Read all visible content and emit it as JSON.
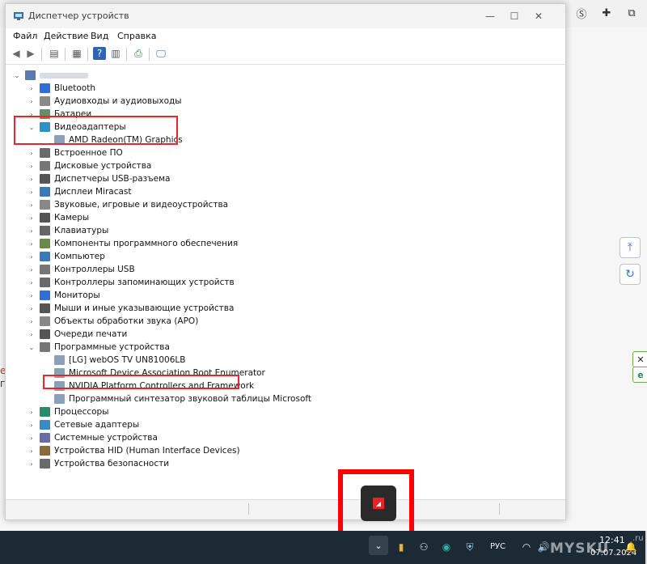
{
  "window": {
    "title": "Диспетчер устройств",
    "minimize": "—",
    "maximize": "☐",
    "close": "✕"
  },
  "menu": [
    "Файл",
    "Действие",
    "Вид",
    "Справка"
  ],
  "tree": {
    "root_expand": "⌄",
    "collapsed_glyph": "›",
    "expanded_glyph": "⌄",
    "items": [
      {
        "label": "Bluetooth"
      },
      {
        "label": "Аудиовходы и аудиовыходы"
      },
      {
        "label": "Батареи"
      },
      {
        "label": "Видеоадаптеры",
        "children": [
          "AMD Radeon(TM) Graphics"
        ]
      },
      {
        "label": "Встроенное ПО"
      },
      {
        "label": "Дисковые устройства"
      },
      {
        "label": "Диспетчеры USB-разъема"
      },
      {
        "label": "Дисплеи Miracast"
      },
      {
        "label": "Звуковые, игровые и видеоустройства"
      },
      {
        "label": "Камеры"
      },
      {
        "label": "Клавиатуры"
      },
      {
        "label": "Компоненты программного обеспечения"
      },
      {
        "label": "Компьютер"
      },
      {
        "label": "Контроллеры USB"
      },
      {
        "label": "Контроллеры запоминающих устройств"
      },
      {
        "label": "Мониторы"
      },
      {
        "label": "Мыши и иные указывающие устройства"
      },
      {
        "label": "Объекты обработки звука (APO)"
      },
      {
        "label": "Очереди печати"
      },
      {
        "label": "Программные устройства",
        "children": [
          "[LG] webOS TV UN81006LB",
          "Microsoft Device Association Root Enumerator",
          "NVIDIA Platform Controllers and Framework",
          "Программный синтезатор звуковой таблицы Microsoft"
        ]
      },
      {
        "label": "Процессоры"
      },
      {
        "label": "Сетевые адаптеры"
      },
      {
        "label": "Системные устройства"
      },
      {
        "label": "Устройства HID (Human Interface Devices)"
      },
      {
        "label": "Устройства безопасности"
      }
    ]
  },
  "taskbar": {
    "language": "РУС",
    "time": "12:41",
    "date": "07.07.2024",
    "watermark": "MYSKU",
    "watermark_suffix": ".ru"
  },
  "background": {
    "left_fragments": [
      "е",
      "гр"
    ]
  },
  "colors": {
    "highlight": "#e5262a",
    "taskbar": "#1c2a36"
  }
}
